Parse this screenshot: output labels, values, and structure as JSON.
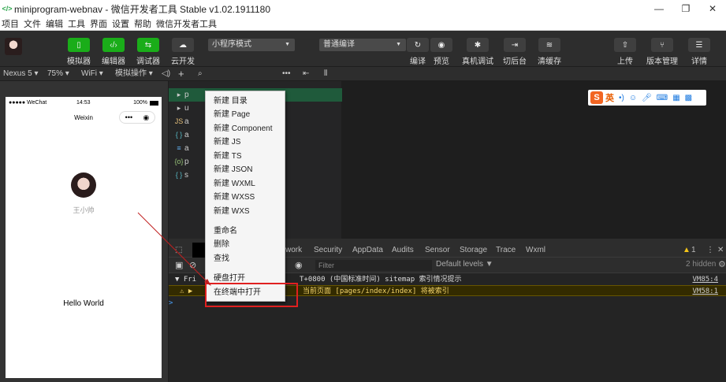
{
  "window": {
    "title": "miniprogram-webnav - 微信开发者工具 Stable v1.02.1911180",
    "logo": "</>"
  },
  "menu": [
    "项目",
    "文件",
    "编辑",
    "工具",
    "界面",
    "设置",
    "帮助",
    "微信开发者工具"
  ],
  "toolbar": {
    "simulator": "模拟器",
    "editor": "编辑器",
    "debugger": "调试器",
    "cloud": "云开发",
    "mode": "小程序模式",
    "compile_mode": "普通编译",
    "compile": "编译",
    "preview": "预览",
    "remote_debug": "真机调试",
    "background": "切后台",
    "clear_cache": "清缓存",
    "upload": "上传",
    "version": "版本管理",
    "details": "详情"
  },
  "simbar": {
    "device": "Nexus 5",
    "zoom": "75%",
    "network": "WiFi",
    "operations": "模拟操作"
  },
  "phone": {
    "carrier": "●●●●● WeChat",
    "time": "14:53",
    "battery": "100%",
    "nav_title": "Weixin",
    "username": "王小帅",
    "hello": "Hello World"
  },
  "filetree": [
    {
      "icon": "▸",
      "name": "p",
      "selected": true
    },
    {
      "icon": "▸",
      "name": "u"
    },
    {
      "icon": "JS",
      "name": "a"
    },
    {
      "icon": "{ }",
      "name": "a"
    },
    {
      "icon": "≡",
      "name": "a"
    },
    {
      "icon": "{o}",
      "name": "p"
    },
    {
      "icon": "{ }",
      "name": "s"
    }
  ],
  "context_menu": {
    "new_dir": "新建 目录",
    "new_page": "新建 Page",
    "new_component": "新建 Component",
    "new_js": "新建 JS",
    "new_ts": "新建 TS",
    "new_json": "新建 JSON",
    "new_wxml": "新建 WXML",
    "new_wxss": "新建 WXSS",
    "new_wxs": "新建 WXS",
    "rename": "重命名",
    "delete": "删除",
    "find": "查找",
    "open_disk": "硬盘打开",
    "open_terminal": "在终端中打开"
  },
  "devtools": {
    "tabs": [
      "work",
      "Security",
      "AppData",
      "Audits",
      "Sensor",
      "Storage",
      "Trace",
      "Wxml"
    ],
    "warn_count": "1",
    "filter_placeholder": "Filter",
    "levels": "Default levels ▼",
    "hidden": "2 hidden",
    "console": [
      {
        "text": "▼ Fri",
        "tail": "T+0800 (中国标准时间) sitemap 索引情况提示",
        "link": "VM85:4"
      },
      {
        "text": "⚠ ▶",
        "tail": "当前页面 [pages/index/index] 将被索引",
        "link": "VM58:1",
        "warn": true
      }
    ],
    "prompt": ">"
  },
  "ime": {
    "logo": "S",
    "lang": "英"
  },
  "colors": {
    "accent_green": "#1aad19",
    "highlight_red": "#e02020",
    "warn_bg": "#332b00"
  }
}
